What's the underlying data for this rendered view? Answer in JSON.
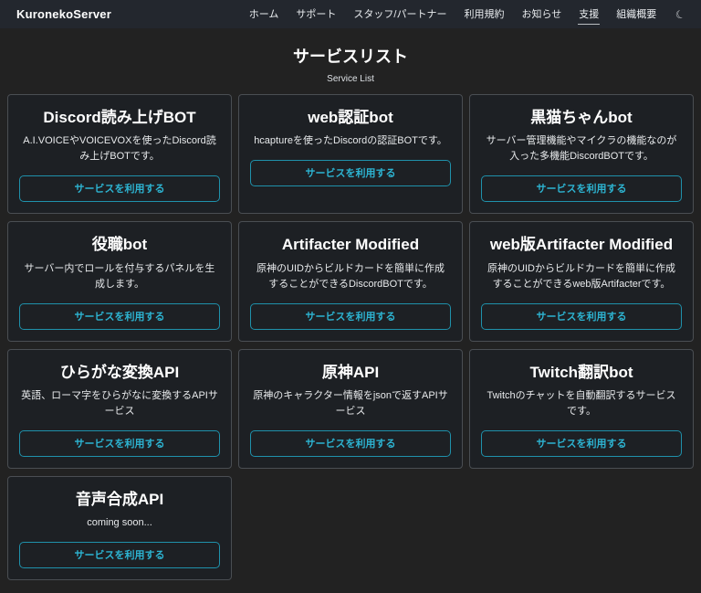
{
  "colors": {
    "body_bg": "#222222",
    "navbar_bg": "#23272e",
    "card_bg": "#1d2024",
    "card_border": "#4a4e53",
    "accent_teal": "#2db4d2",
    "button_border": "#1f91ab"
  },
  "navbar": {
    "brand": "KuronekoServer",
    "items": [
      {
        "label": "ホーム",
        "active": false
      },
      {
        "label": "サポート",
        "active": false
      },
      {
        "label": "スタッフ/パートナー",
        "active": false
      },
      {
        "label": "利用規約",
        "active": false
      },
      {
        "label": "お知らせ",
        "active": false
      },
      {
        "label": "支援",
        "active": true
      },
      {
        "label": "組織概要",
        "active": false
      }
    ],
    "theme_toggle_glyph": "☾"
  },
  "page": {
    "title": "サービスリスト",
    "subtitle": "Service List"
  },
  "services": {
    "button_label": "サービスを利用する",
    "cards": [
      {
        "title": "Discord読み上げBOT",
        "description": "A.I.VOICEやVOICEVOXを使ったDiscord読み上げBOTです。"
      },
      {
        "title": "web認証bot",
        "description": "hcaptureを使ったDiscordの認証BOTです。"
      },
      {
        "title": "黒猫ちゃんbot",
        "description": "サーバー管理機能やマイクラの機能なのが入った多機能DiscordBOTです。"
      },
      {
        "title": "役職bot",
        "description": "サーバー内でロールを付与するパネルを生成します。"
      },
      {
        "title": "Artifacter Modified",
        "description": "原神のUIDからビルドカードを簡単に作成することができるDiscordBOTです。"
      },
      {
        "title": "web版Artifacter Modified",
        "description": "原神のUIDからビルドカードを簡単に作成することができるweb版Artifacterです。"
      },
      {
        "title": "ひらがな変換API",
        "description": "英語、ローマ字をひらがなに変換するAPIサービス"
      },
      {
        "title": "原神API",
        "description": "原神のキャラクター情報をjsonで返すAPIサービス"
      },
      {
        "title": "Twitch翻訳bot",
        "description": "Twitchのチャットを自動翻訳するサービスです。"
      },
      {
        "title": "音声合成API",
        "description": "coming soon..."
      }
    ]
  }
}
